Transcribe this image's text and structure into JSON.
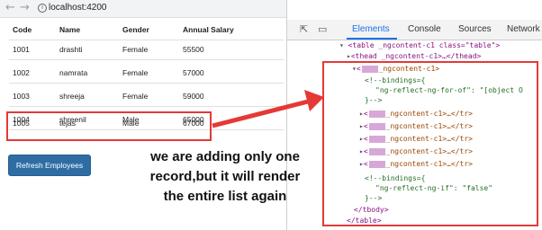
{
  "browser": {
    "back_icon": "←",
    "forward_icon": "→",
    "reload_icon": "↻",
    "info_icon": "i",
    "url": "localhost:4200"
  },
  "table": {
    "headers": [
      "Code",
      "Name",
      "Gender",
      "Annual Salary"
    ],
    "rows": [
      [
        "1001",
        "drashti",
        "Female",
        "55500"
      ],
      [
        "1002",
        "namrata",
        "Female",
        "57000"
      ],
      [
        "1003",
        "shreeja",
        "Female",
        "59000"
      ],
      [
        "1004",
        "shreenil",
        "Male",
        "65000"
      ],
      [
        "1005",
        "tejas",
        "Male",
        "67000"
      ]
    ]
  },
  "refresh_label": "Refresh Employees",
  "annotation": [
    "we are adding only one",
    "record,but it will render",
    "the entire list again"
  ],
  "devtools": {
    "tabs": [
      "Elements",
      "Console",
      "Sources",
      "Network"
    ],
    "tools": [
      "⇱",
      "▭"
    ],
    "code": {
      "table_open": "<table _ngcontent-c1 class=\"table\">",
      "thead": "<thead _ngcontent-c1>…</thead>",
      "tbody_open": "_ngcontent-c1>",
      "bindings1": "<!--bindings={",
      "for_of": "\"ng-reflect-ng-for-of\": \"[object O",
      "close1": "}-->",
      "tr_row": "_ngcontent-c1>…</tr>",
      "bindings2": "<!--bindings={",
      "ng_if": "\"ng-reflect-ng-if\": \"false\"",
      "close2": "}-->",
      "tbody_close": "</tbody>",
      "table_close": "</table>"
    }
  },
  "colors": {
    "highlight": "#e53935",
    "button": "#2e6da4",
    "tab_active": "#1a73e8"
  }
}
